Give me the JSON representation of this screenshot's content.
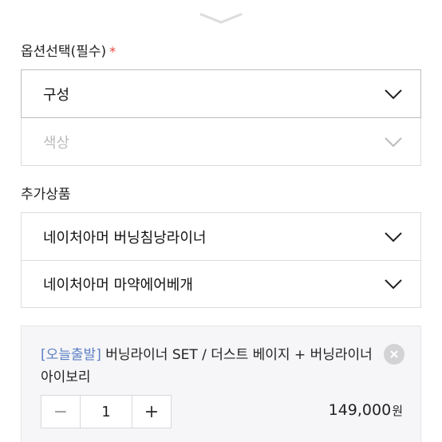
{
  "handle": {
    "icon": "chevron-down-icon"
  },
  "options": {
    "label": "옵션선택(필수)",
    "required_mark": "*",
    "selects": [
      {
        "value": "구성",
        "state": "active",
        "icon": "chevron-down-icon"
      },
      {
        "value": "색상",
        "state": "disabled",
        "icon": "chevron-down-icon"
      }
    ]
  },
  "addons": {
    "label": "추가상품",
    "items": [
      {
        "label": "네이처아머 버닝침낭라이너",
        "icon": "chevron-down-icon"
      },
      {
        "label": "네이처아머 마약에어베개",
        "icon": "chevron-down-icon"
      }
    ]
  },
  "selected_item": {
    "tag": "[오늘출발]",
    "name": "버닝라이너 SET / 더스트 베이지 + 버닝라이너 아이보리",
    "quantity": "1",
    "minus": "−",
    "plus": "+",
    "price": "149,000",
    "currency": "원",
    "remove_icon": "close-icon"
  },
  "colors": {
    "required": "#e8453c",
    "tag": "#5b7fc4",
    "border": "#dcdcdc",
    "selected_bg": "#f6f6f8"
  }
}
